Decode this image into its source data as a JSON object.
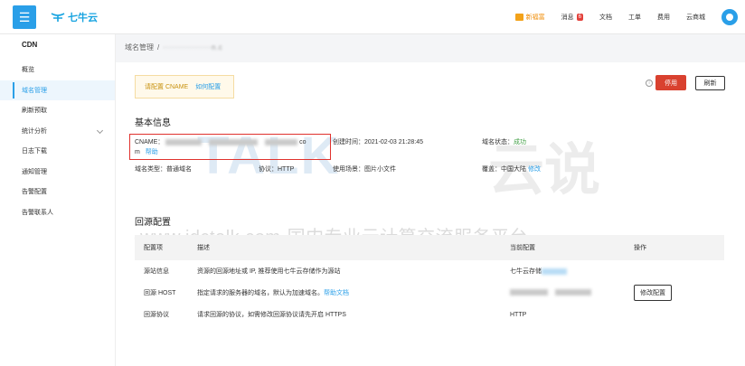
{
  "topbar": {
    "menu_glyph": "☰",
    "brand": "七牛云",
    "nav": [
      {
        "label": "新福富",
        "icon": "gift-icon",
        "accent": "#f08a00"
      },
      {
        "label": "消息",
        "badge": "6"
      },
      {
        "label": "文档"
      },
      {
        "label": "工单"
      },
      {
        "label": "费用"
      },
      {
        "label": "云商城"
      }
    ]
  },
  "sidebar": {
    "title": "CDN",
    "items": [
      {
        "label": "概览"
      },
      {
        "label": "域名管理",
        "active": true
      },
      {
        "label": "刷新预取"
      },
      {
        "label": "统计分析",
        "expandable": true
      },
      {
        "label": "日志下载"
      },
      {
        "label": "通知管理"
      },
      {
        "label": "告警配置"
      },
      {
        "label": "告警联系人"
      }
    ]
  },
  "breadcrumb": {
    "root": "域名管理",
    "sep": "/",
    "current": "·················n.c"
  },
  "tip": {
    "text": "请配置 CNAME",
    "link": "如何配置"
  },
  "actions": {
    "info": "i",
    "stop": "停用",
    "refresh": "刷新"
  },
  "basic": {
    "title": "基本信息",
    "cname_label": "CNAME：",
    "cname_tail": "co",
    "cname_wrap": "m",
    "help": "帮助",
    "created_label": "创建时间：",
    "created_value": "2021-02-03 21:28:45",
    "status_label": "域名状态：",
    "status_value": "成功",
    "type_label": "域名类型：",
    "type_value": "普通域名",
    "protocol_label": "协议：",
    "protocol_value": "HTTP",
    "scene_label": "使用场景：",
    "scene_value": "图片小文件",
    "coverage_label": "覆盖：",
    "coverage_value": "中国大陆",
    "coverage_edit": "修改"
  },
  "watermark": {
    "big": "TALK",
    "cn": "云说",
    "line": "-www.idctalk.com-国内专业云计算交流服务平台-"
  },
  "origin": {
    "title": "回源配置",
    "headers": [
      "配置项",
      "描述",
      "当前配置",
      "操作"
    ],
    "rows": [
      {
        "item": "源站信息",
        "desc": "资源的回源地址或 IP, 推荐使用七牛云存储作为源站",
        "current": "七牛云存储",
        "action": ""
      },
      {
        "item": "回源 HOST",
        "desc": "指定请求的服务器的域名，默认为加速域名。",
        "desc_link": "帮助文档",
        "current": "",
        "action": "修改配置"
      },
      {
        "item": "回源协议",
        "desc": "请求回源的协议，如需修改回源协议请先开启 HTTPS",
        "current": "HTTP",
        "action": ""
      }
    ]
  }
}
